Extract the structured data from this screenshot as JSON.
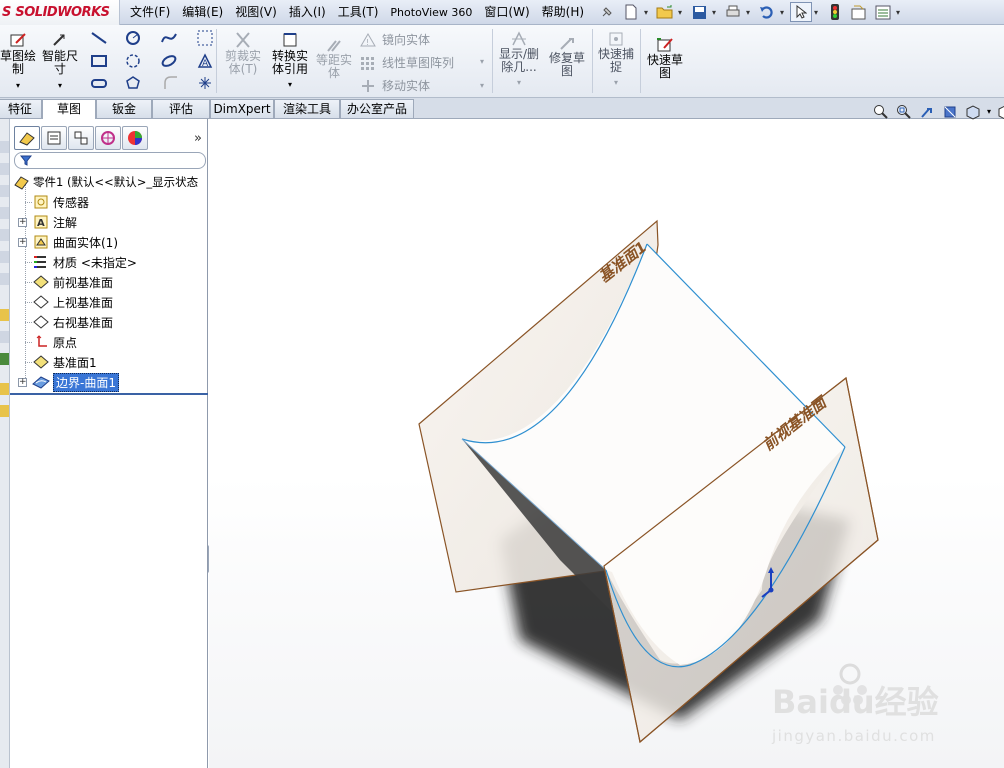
{
  "app": {
    "brand": "SOLIDWORKS",
    "brand_prefix": "S"
  },
  "menu": [
    {
      "id": "file",
      "label": "文件(F)"
    },
    {
      "id": "edit",
      "label": "编辑(E)"
    },
    {
      "id": "view",
      "label": "视图(V)"
    },
    {
      "id": "insert",
      "label": "插入(I)"
    },
    {
      "id": "tools",
      "label": "工具(T)"
    },
    {
      "id": "photoview",
      "label": "PhotoView 360"
    },
    {
      "id": "window",
      "label": "窗口(W)"
    },
    {
      "id": "help",
      "label": "帮助(H)"
    }
  ],
  "ribbon": {
    "sketch": "草图绘\n制",
    "smart_dim": "智能尺\n寸",
    "trim": "剪裁实\n体(T)",
    "convert": "转换实\n体引用",
    "offset": "等距实\n体",
    "mirror": "镜向实体",
    "linear_pattern": "线性草图阵列",
    "move": "移动实体",
    "show_delete": "显示/删\n除几...",
    "repair": "修复草\n图",
    "quick_snap": "快速捕\n捉",
    "rapid_sketch": "快速草\n图"
  },
  "tabs": [
    {
      "label": "特征",
      "active": false
    },
    {
      "label": "草图",
      "active": true
    },
    {
      "label": "钣金",
      "active": false
    },
    {
      "label": "评估",
      "active": false
    },
    {
      "label": "DimXpert",
      "active": false
    },
    {
      "label": "渲染工具",
      "active": false
    },
    {
      "label": "办公室产品",
      "active": false
    }
  ],
  "tree": {
    "root": "零件1 (默认<<默认>_显示状态",
    "items": [
      {
        "label": "传感器",
        "icon": "sensor-icon",
        "expandable": false
      },
      {
        "label": "注解",
        "icon": "annotation-icon",
        "expandable": true
      },
      {
        "label": "曲面实体(1)",
        "icon": "surface-body-icon",
        "expandable": true
      },
      {
        "label": "材质 <未指定>",
        "icon": "material-icon",
        "expandable": false
      },
      {
        "label": "前视基准面",
        "icon": "plane-icon",
        "expandable": false
      },
      {
        "label": "上视基准面",
        "icon": "plane-icon",
        "expandable": false
      },
      {
        "label": "右视基准面",
        "icon": "plane-icon",
        "expandable": false
      },
      {
        "label": "原点",
        "icon": "origin-icon",
        "expandable": false
      },
      {
        "label": "基准面1",
        "icon": "plane-icon",
        "expandable": false
      },
      {
        "label": "边界-曲面1",
        "icon": "boundary-surface-icon",
        "expandable": true,
        "selected": true
      }
    ]
  },
  "viewport": {
    "plane1_label": "基准面1",
    "front_plane_label": "前视基准面",
    "watermark": "Baidu经验",
    "watermark_url": "jingyan.baidu.com"
  },
  "colors": {
    "plane_border": "#8a5426",
    "surface_edge": "#2e8fd0",
    "selection": "#3a76d6",
    "brand": "#c8102e"
  }
}
